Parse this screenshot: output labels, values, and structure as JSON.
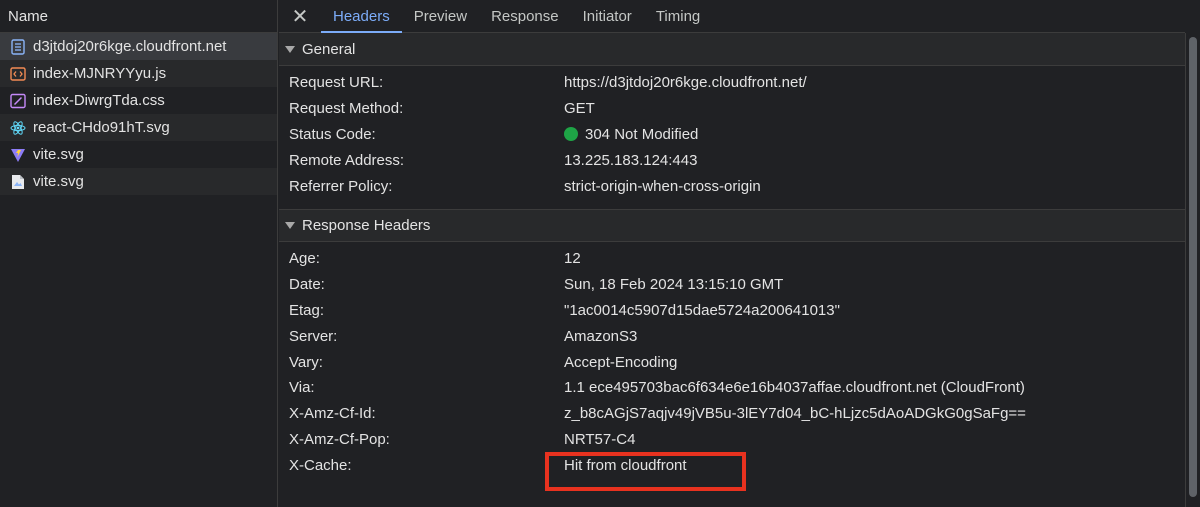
{
  "sidebar": {
    "header": "Name",
    "items": [
      {
        "name": "d3jtdoj20r6kge.cloudfront.net",
        "icon": "document-icon",
        "selected": true
      },
      {
        "name": "index-MJNRYYyu.js",
        "icon": "script-icon"
      },
      {
        "name": "index-DiwrgTda.css",
        "icon": "stylesheet-icon"
      },
      {
        "name": "react-CHdo91hT.svg",
        "icon": "react-logo-icon"
      },
      {
        "name": "vite.svg",
        "icon": "vite-logo-icon"
      },
      {
        "name": "vite.svg",
        "icon": "image-file-icon"
      }
    ]
  },
  "tabs": {
    "close_glyph": "✕",
    "items": [
      "Headers",
      "Preview",
      "Response",
      "Initiator",
      "Timing"
    ],
    "active": "Headers"
  },
  "general": {
    "title": "General",
    "rows": [
      {
        "key": "Request URL:",
        "value": "https://d3jtdoj20r6kge.cloudfront.net/"
      },
      {
        "key": "Request Method:",
        "value": "GET"
      },
      {
        "key": "Status Code:",
        "value": "304 Not Modified",
        "status_color": "#1ea446"
      },
      {
        "key": "Remote Address:",
        "value": "13.225.183.124:443"
      },
      {
        "key": "Referrer Policy:",
        "value": "strict-origin-when-cross-origin"
      }
    ]
  },
  "response_headers": {
    "title": "Response Headers",
    "rows": [
      {
        "key": "Age:",
        "value": "12"
      },
      {
        "key": "Date:",
        "value": "Sun, 18 Feb 2024 13:15:10 GMT"
      },
      {
        "key": "Etag:",
        "value": "\"1ac0014c5907d15dae5724a200641013\""
      },
      {
        "key": "Server:",
        "value": "AmazonS3"
      },
      {
        "key": "Vary:",
        "value": "Accept-Encoding"
      },
      {
        "key": "Via:",
        "value": "1.1 ece495703bac6f634e6e16b4037affae.cloudfront.net (CloudFront)"
      },
      {
        "key": "X-Amz-Cf-Id:",
        "value": "z_b8cAGjS7aqjv49jVB5u-3lEY7d04_bC-hLjzc5dAoADGkG0gSaFg=="
      },
      {
        "key": "X-Amz-Cf-Pop:",
        "value": "NRT57-C4"
      },
      {
        "key": "X-Cache:",
        "value": "Hit from cloudfront"
      }
    ]
  },
  "colors": {
    "accent": "#7cacf8",
    "highlight": "#e8321f",
    "status_ok": "#1ea446"
  }
}
